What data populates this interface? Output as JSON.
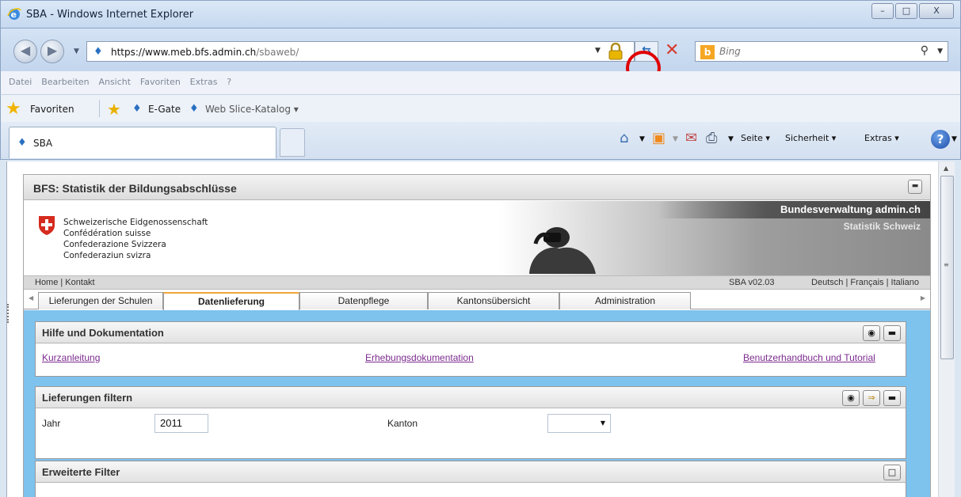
{
  "window": {
    "title": "SBA - Windows Internet Explorer",
    "buttons": {
      "minimize": "–",
      "maximize": "□",
      "close": "X"
    }
  },
  "addressbar": {
    "url_host": "https://www.meb.bfs.admin.ch",
    "url_path": "/sbaweb/"
  },
  "search": {
    "placeholder": "Bing"
  },
  "menubar": {
    "items": [
      "Datei",
      "Bearbeiten",
      "Ansicht",
      "Favoriten",
      "Extras",
      "?"
    ]
  },
  "favorites": {
    "label": "Favoriten",
    "items": [
      "E-Gate",
      "Web Slice-Katalog ▾"
    ]
  },
  "tab": {
    "label": "SBA"
  },
  "commandbar": {
    "seite": "Seite ▾",
    "sicherheit": "Sicherheit ▾",
    "extras": "Extras ▾",
    "help": "?"
  },
  "app": {
    "title": "BFS: Statistik der Bildungsabschlüsse",
    "confederation": [
      "Schweizerische Eidgenossenschaft",
      "Confédération suisse",
      "Confederazione Svizzera",
      "Confederaziun svizra"
    ],
    "banner_right_1": "Bundesverwaltung admin.ch",
    "banner_right_2": "Statistik Schweiz",
    "links_left": "Home | Kontakt",
    "version": "SBA v02.03",
    "languages": "Deutsch | Français | Italiano",
    "tabs": [
      "Lieferungen der Schulen",
      "Datenlieferung",
      "Datenpflege",
      "Kantonsübersicht",
      "Administration"
    ],
    "active_tab": "Datenlieferung"
  },
  "help_panel": {
    "title": "Hilfe und Dokumentation",
    "links": [
      "Kurzanleitung",
      "Erhebungsdokumentation",
      "Benutzerhandbuch und Tutorial"
    ]
  },
  "filter_panel": {
    "title": "Lieferungen filtern",
    "year_label": "Jahr",
    "year_value": "2011",
    "canton_label": "Kanton",
    "canton_value": ""
  },
  "advanced_panel": {
    "title": "Erweiterte Filter"
  },
  "colors": {
    "accent_blue": "#7ec2ee",
    "highlight_ring": "#e00000",
    "active_tab_border": "#f1a43a",
    "swiss_red": "#d52b1e"
  }
}
